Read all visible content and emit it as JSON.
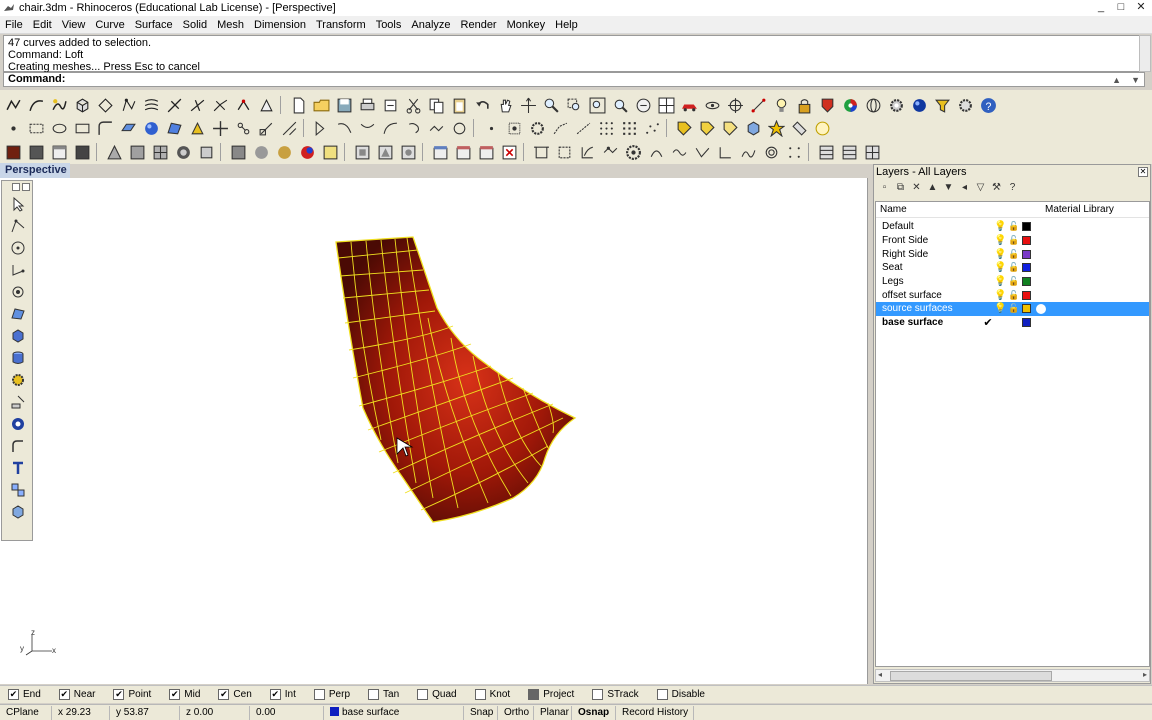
{
  "window": {
    "title": "chair.3dm - Rhinoceros (Educational Lab License) - [Perspective]",
    "controls": [
      "_",
      "□",
      "✕"
    ]
  },
  "menu": [
    "File",
    "Edit",
    "View",
    "Curve",
    "Surface",
    "Solid",
    "Mesh",
    "Dimension",
    "Transform",
    "Tools",
    "Analyze",
    "Render",
    "Monkey",
    "Help"
  ],
  "command_history": [
    "47 curves added to selection.",
    "Command: Loft",
    "Creating meshes... Press Esc to cancel"
  ],
  "command_prompt": "Command:",
  "viewport": {
    "name": "Perspective"
  },
  "layers_panel": {
    "title": "Layers - All Layers",
    "columns": {
      "name": "Name",
      "material": "Material Library"
    },
    "layers": [
      {
        "name": "Default",
        "color": "#000000"
      },
      {
        "name": "Front Side",
        "color": "#e81010"
      },
      {
        "name": "Right Side",
        "color": "#7a3ac8"
      },
      {
        "name": "Seat",
        "color": "#1020e0"
      },
      {
        "name": "Legs",
        "color": "#108020"
      },
      {
        "name": "offset surface",
        "color": "#e81010"
      },
      {
        "name": "source surfaces",
        "color": "#f0c000"
      },
      {
        "name": "base surface",
        "color": "#1020c0"
      }
    ],
    "selected_layer": "source surfaces",
    "current_layer": "base surface",
    "current_mark": "✔"
  },
  "osnap": [
    {
      "label": "End",
      "checked": true
    },
    {
      "label": "Near",
      "checked": true
    },
    {
      "label": "Point",
      "checked": true
    },
    {
      "label": "Mid",
      "checked": true
    },
    {
      "label": "Cen",
      "checked": true
    },
    {
      "label": "Int",
      "checked": true
    },
    {
      "label": "Perp",
      "checked": false
    },
    {
      "label": "Tan",
      "checked": false
    },
    {
      "label": "Quad",
      "checked": false
    },
    {
      "label": "Knot",
      "checked": false
    },
    {
      "label": "Project",
      "checked": false
    },
    {
      "label": "STrack",
      "checked": false
    },
    {
      "label": "Disable",
      "checked": false
    }
  ],
  "status": {
    "cplane": "CPlane",
    "x": "x 29.23",
    "y": "y 53.87",
    "z": "z 0.00",
    "dist": "0.00",
    "layer": "base surface",
    "snap": "Snap",
    "ortho": "Ortho",
    "planar": "Planar",
    "osnap": "Osnap",
    "record": "Record History"
  },
  "axes": {
    "x": "x",
    "y": "y",
    "z": "z"
  },
  "accent": "#3399ff",
  "surface_color": "#a01808",
  "wire_color": "#f0e020"
}
